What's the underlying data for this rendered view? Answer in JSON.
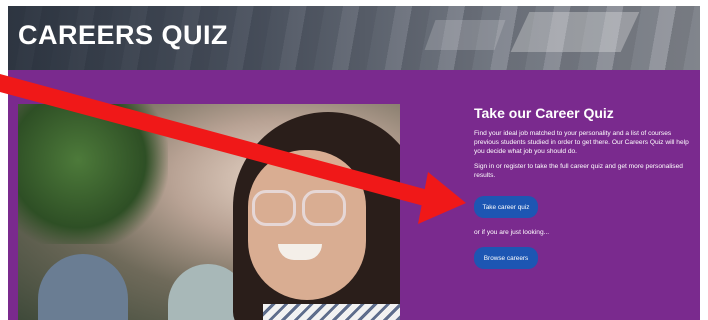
{
  "header": {
    "title": "CAREERS QUIZ"
  },
  "quiz": {
    "heading": "Take our Career Quiz",
    "intro": "Find your ideal job matched to your personality and a list of courses previous students studied in order to get there. Our Careers Quiz will help you decide what job you should do.",
    "signin_note": "Sign in or register to take the full career quiz and get more personalised results.",
    "take_quiz_label": "Take career quiz",
    "looking_text": "or if you are just looking...",
    "browse_label": "Browse careers"
  },
  "colors": {
    "panel_purple": "#7a2a8e",
    "button_blue": "#1d56b3",
    "annotation_red": "#f01818"
  }
}
